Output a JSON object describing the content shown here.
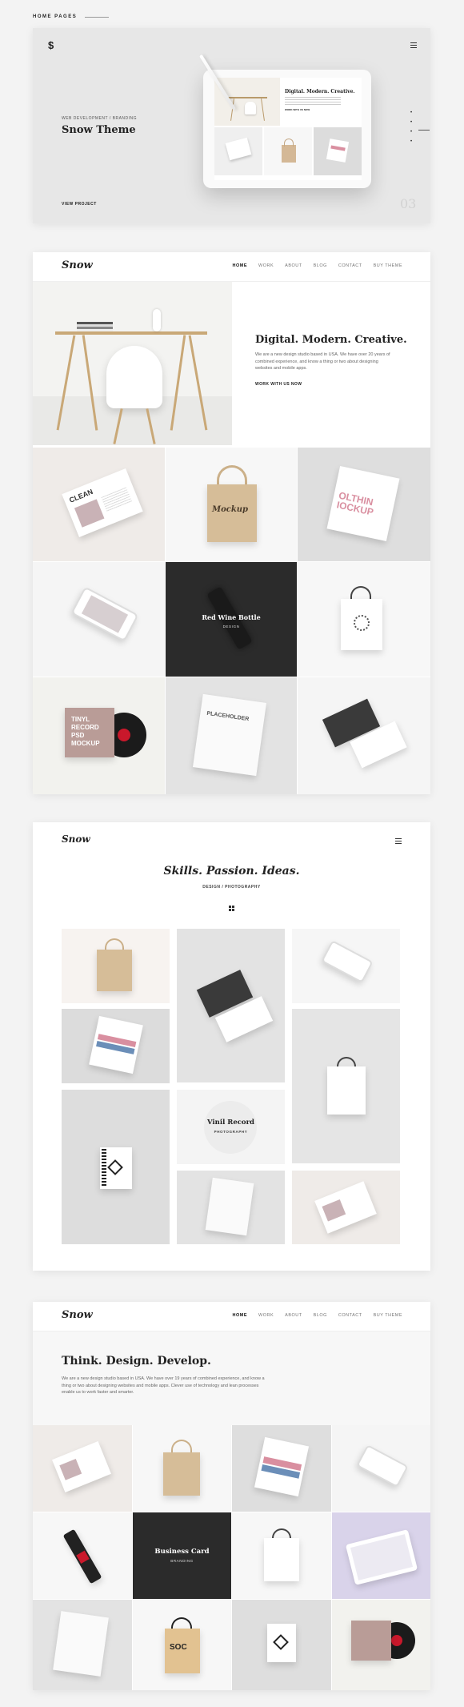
{
  "page": {
    "section_label": "HOME PAGES"
  },
  "slide": {
    "logo": "$",
    "subtitle": "WEB DEVELOPMENT / BRANDING",
    "title": "Snow Theme",
    "cta": "VIEW PROJECT",
    "number": "03",
    "dots": [
      "•",
      "•",
      "•",
      "•"
    ],
    "tablet_heading": "Digital. Modern. Creative.",
    "tablet_cta": "WORK WITH US NOW"
  },
  "nav": {
    "logo": "Snow",
    "links": [
      "HOME",
      "WORK",
      "ABOUT",
      "BLOG",
      "CONTACT",
      "BUY THEME"
    ]
  },
  "home1": {
    "heading": "Digital. Modern. Creative.",
    "body": "We are a new design studio based in USA. We have over 20 years of combined experience, and know a thing or two about designing websites and mobile apps.",
    "cta": "WORK WITH US NOW",
    "featured_title": "Red Wine Bottle",
    "featured_category": "DESIGN",
    "mockup_texts": {
      "magazine": "CLEAN",
      "tote": "Mockup",
      "tshirt": "OLTHIN IOCKUP",
      "vinyl_l1": "TINYL",
      "vinyl_l2": "RECORD",
      "vinyl_l3": "PSD",
      "vinyl_l4": "MOCKUP",
      "placeholder": "PLACEHOLDER"
    }
  },
  "home2": {
    "logo": "Snow",
    "heading": "Skills. Passion. Ideas.",
    "subheading": "DESIGN / PHOTOGRAPHY",
    "featured_title": "Vinil Record",
    "featured_category": "PHOTOGRAPHY"
  },
  "home3": {
    "heading": "Think. Design. Develop.",
    "body": "We are a new design studio based in USA. We have over 19 years of combined experience, and know a thing or two about designing websites and mobile apps. Clever use of technology and lean processes enable us to work faster and smarter.",
    "featured_title": "Business Card",
    "featured_category": "BRANDING",
    "bag_text": "SOC"
  },
  "colors": {
    "accent_pink": "#d98fa0",
    "accent_blue": "#6b8eb8",
    "dark_tile": "#2b2b2b",
    "lavender": "#d9d3ea"
  }
}
